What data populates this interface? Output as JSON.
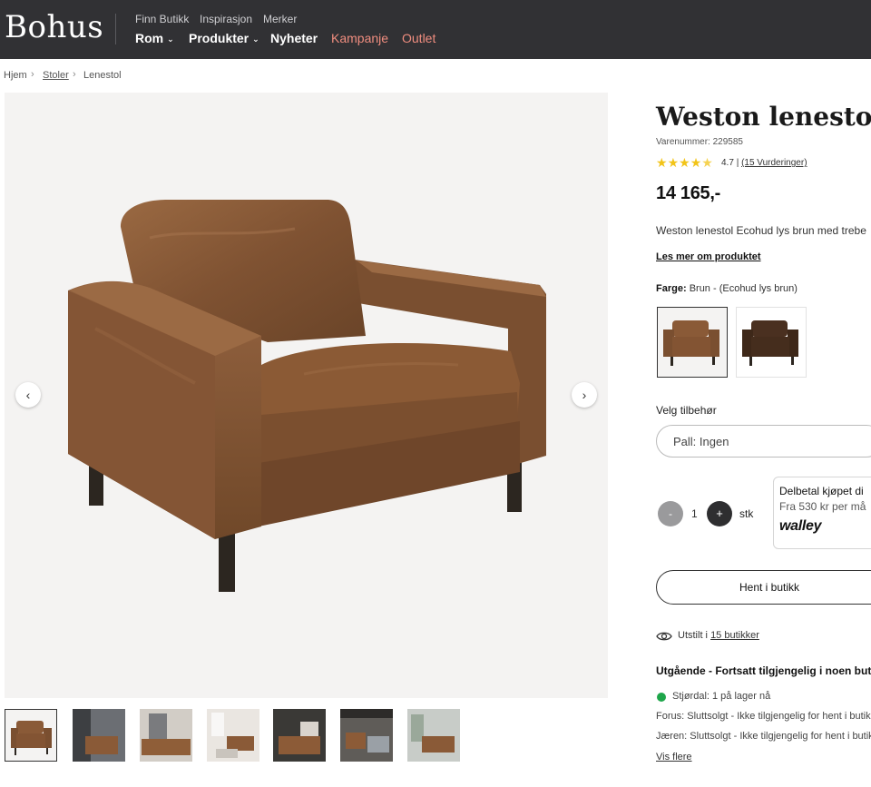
{
  "header": {
    "logo": "Bohus",
    "top_links": [
      "Finn Butikk",
      "Inspirasjon",
      "Merker"
    ],
    "nav": [
      {
        "label": "Rom",
        "dropdown": true
      },
      {
        "label": "Produkter",
        "dropdown": true
      },
      {
        "label": "Nyheter",
        "dropdown": false
      },
      {
        "label": "Kampanje",
        "dropdown": false
      },
      {
        "label": "Outlet",
        "dropdown": false
      }
    ]
  },
  "breadcrumb": [
    "Hjem",
    "Stoler",
    "Lenestol"
  ],
  "product": {
    "title": "Weston lenestol",
    "sku": "Varenummer: 229585",
    "rating_value": "4.7",
    "rating_separator": "|",
    "rating_count": "(15 Vurderinger)",
    "price": "14 165,-",
    "description": "Weston lenestol Ecohud lys brun med trebe",
    "read_more": "Les mer om produktet",
    "color_label": "Farge:",
    "color_value": "Brun - (Ecohud lys brun)",
    "accessory_label": "Velg tilbehør",
    "accessory_value": "Pall: Ingen",
    "qty_minus": "-",
    "qty_value": "1",
    "qty_plus": "+",
    "qty_unit": "stk",
    "walley_line1": "Delbetal kjøpet di",
    "walley_line2": "Fra 530 kr per må",
    "walley_logo": "walley",
    "pickup_button": "Hent i butikk",
    "shown_prefix": "Utstilt i",
    "shown_link": "15 butikker",
    "availability_title": "Utgående - Fortsatt tilgjengelig i noen buti",
    "stock": [
      "Stjørdal: 1 på lager nå",
      "Forus: Sluttsolgt - Ikke tilgjengelig for hent i butik",
      "Jæren: Sluttsolgt - Ikke tilgjengelig for hent i butik"
    ],
    "more_link": "Vis flere"
  },
  "gallery": {
    "prev_icon": "chevron-left-icon",
    "next_icon": "chevron-right-icon"
  },
  "colors": {
    "header_bg": "#313134",
    "accent": "#f08d7f",
    "star": "#f2c418",
    "in_stock": "#1ea64a",
    "leather": "#8a5a37"
  }
}
